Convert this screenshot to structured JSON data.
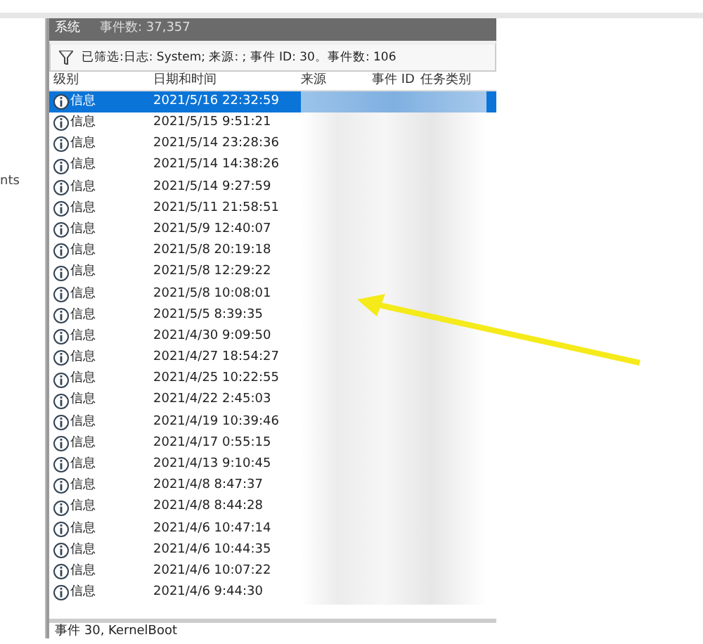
{
  "left_pane": {
    "text": "nts"
  },
  "header": {
    "title": "系统",
    "count": "事件数: 37,357"
  },
  "filter": {
    "text": "已筛选:日志: System; 来源: ; 事件 ID: 30。事件数: 106"
  },
  "columns": [
    "级别",
    "日期和时间",
    "来源",
    "事件 ID",
    "任务类别"
  ],
  "rows": [
    {
      "level": "信息",
      "datetime": "2021/5/16 22:32:59",
      "selected": true
    },
    {
      "level": "信息",
      "datetime": "2021/5/15 9:51:21",
      "selected": false
    },
    {
      "level": "信息",
      "datetime": "2021/5/14 23:28:36",
      "selected": false
    },
    {
      "level": "信息",
      "datetime": "2021/5/14 14:38:26",
      "selected": false
    },
    {
      "level": "信息",
      "datetime": "2021/5/14 9:27:59",
      "selected": false
    },
    {
      "level": "信息",
      "datetime": "2021/5/11 21:58:51",
      "selected": false
    },
    {
      "level": "信息",
      "datetime": "2021/5/9 12:40:07",
      "selected": false
    },
    {
      "level": "信息",
      "datetime": "2021/5/8 20:19:18",
      "selected": false
    },
    {
      "level": "信息",
      "datetime": "2021/5/8 12:29:22",
      "selected": false
    },
    {
      "level": "信息",
      "datetime": "2021/5/8 10:08:01",
      "selected": false
    },
    {
      "level": "信息",
      "datetime": "2021/5/5 8:39:35",
      "selected": false
    },
    {
      "level": "信息",
      "datetime": "2021/4/30 9:09:50",
      "selected": false
    },
    {
      "level": "信息",
      "datetime": "2021/4/27 18:54:27",
      "selected": false
    },
    {
      "level": "信息",
      "datetime": "2021/4/25 10:22:55",
      "selected": false
    },
    {
      "level": "信息",
      "datetime": "2021/4/22 2:45:03",
      "selected": false
    },
    {
      "level": "信息",
      "datetime": "2021/4/19 10:39:46",
      "selected": false
    },
    {
      "level": "信息",
      "datetime": "2021/4/17 0:55:15",
      "selected": false
    },
    {
      "level": "信息",
      "datetime": "2021/4/13 9:10:45",
      "selected": false
    },
    {
      "level": "信息",
      "datetime": "2021/4/8 8:47:37",
      "selected": false
    },
    {
      "level": "信息",
      "datetime": "2021/4/8 8:44:28",
      "selected": false
    },
    {
      "level": "信息",
      "datetime": "2021/4/6 10:47:14",
      "selected": false
    },
    {
      "level": "信息",
      "datetime": "2021/4/6 10:44:35",
      "selected": false
    },
    {
      "level": "信息",
      "datetime": "2021/4/6 10:07:22",
      "selected": false
    },
    {
      "level": "信息",
      "datetime": "2021/4/6 9:44:30",
      "selected": false
    }
  ],
  "detail": {
    "title": "事件 30, KernelBoot"
  }
}
